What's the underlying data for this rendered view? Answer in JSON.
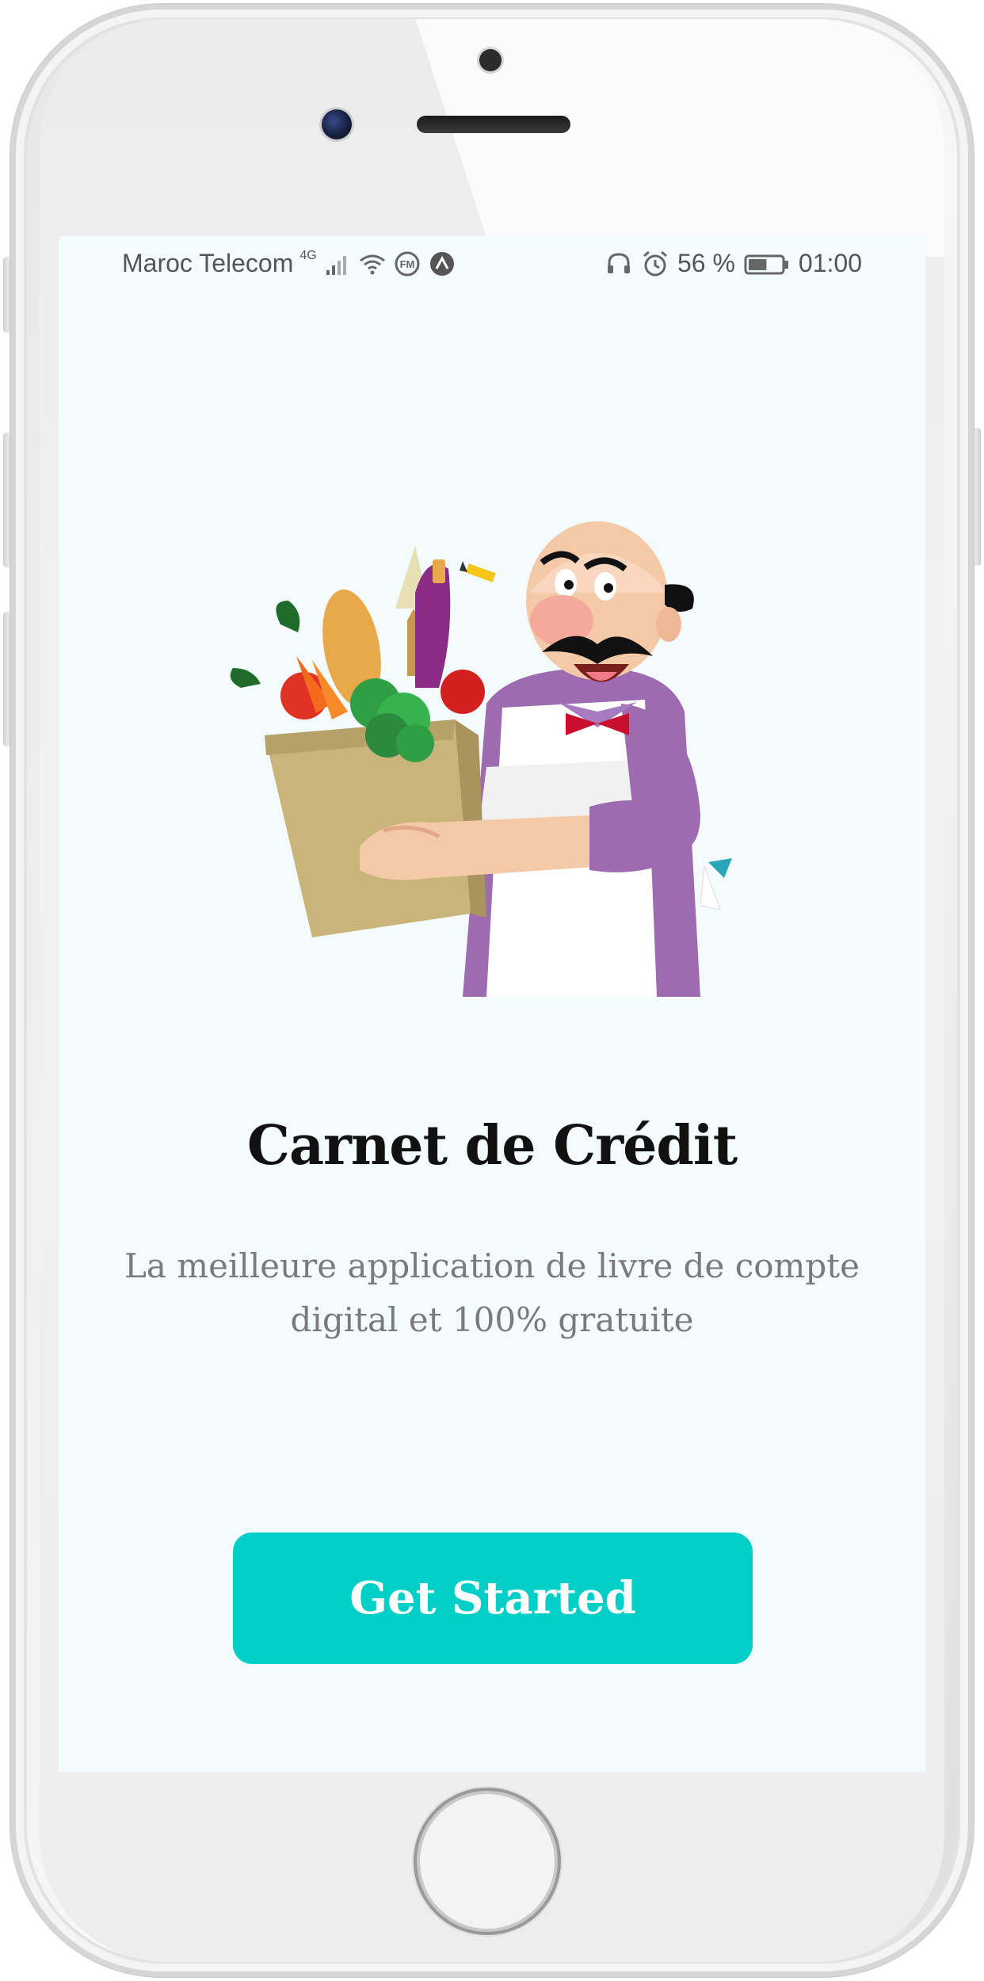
{
  "status_bar": {
    "carrier": "Maroc Telecom",
    "network_type": "4G",
    "battery_percent": "56 %",
    "time": "01:00",
    "left_icons": [
      "signal-icon",
      "wifi-icon",
      "fm-radio-icon",
      "app-notification-icon"
    ],
    "right_icons": [
      "headphones-icon",
      "alarm-icon",
      "battery-icon"
    ],
    "battery_level": 0.56
  },
  "onboarding": {
    "illustration": "grocer-with-vegetable-bag",
    "title": "Carnet de Crédit",
    "subtitle": "La meilleure application de livre de compte digital et 100% gratuite",
    "cta_label": "Get Started"
  },
  "colors": {
    "screen_background": "#f3fbfc",
    "accent": "#00cfc7",
    "title_text": "#111111",
    "subtitle_text": "#7a7a7a"
  }
}
